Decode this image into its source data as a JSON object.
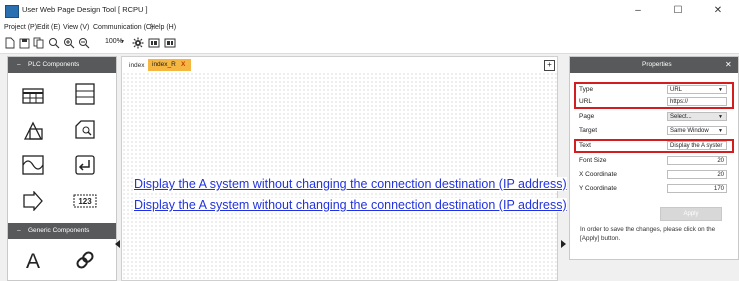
{
  "window": {
    "title": "User Web Page Design Tool [ RCPU ]",
    "minimize": "–",
    "maximize": "☐",
    "close": "✕"
  },
  "menu": [
    "Project (P)",
    "Edit (E)",
    "View (V)",
    "Communication (C)",
    "Help (H)"
  ],
  "toolbar": {
    "zoom": "100%"
  },
  "left_panel": {
    "section1": "PLC Components",
    "section2": "Generic Components",
    "collapse": "–"
  },
  "editor": {
    "tabs": [
      "index",
      "index_R"
    ],
    "tab_close": "X",
    "expand": "+",
    "links": [
      "Display the A system without changing the connection destination (IP address)",
      "Display the A system without changing the connection destination (IP address)"
    ]
  },
  "properties": {
    "title": "Properties",
    "close": "✕",
    "rows": [
      {
        "label": "Type",
        "value": "URL"
      },
      {
        "label": "URL",
        "value": "https://"
      },
      {
        "label": "Page",
        "value": "Select..."
      },
      {
        "label": "Target",
        "value": "Same Window"
      },
      {
        "label": "Text",
        "value": "Display the A syster"
      },
      {
        "label": "Font Size",
        "value": "20"
      },
      {
        "label": "X Coordinate",
        "value": "20"
      },
      {
        "label": "Y Coordinate",
        "value": "170"
      }
    ],
    "apply": "Apply",
    "note": "In order to save the changes, please click on the [Apply] button."
  },
  "colors": {
    "panel_header": "#57595b",
    "active_tab": "#f5b642",
    "link": "#2233dd",
    "highlight": "#d21e1e"
  }
}
